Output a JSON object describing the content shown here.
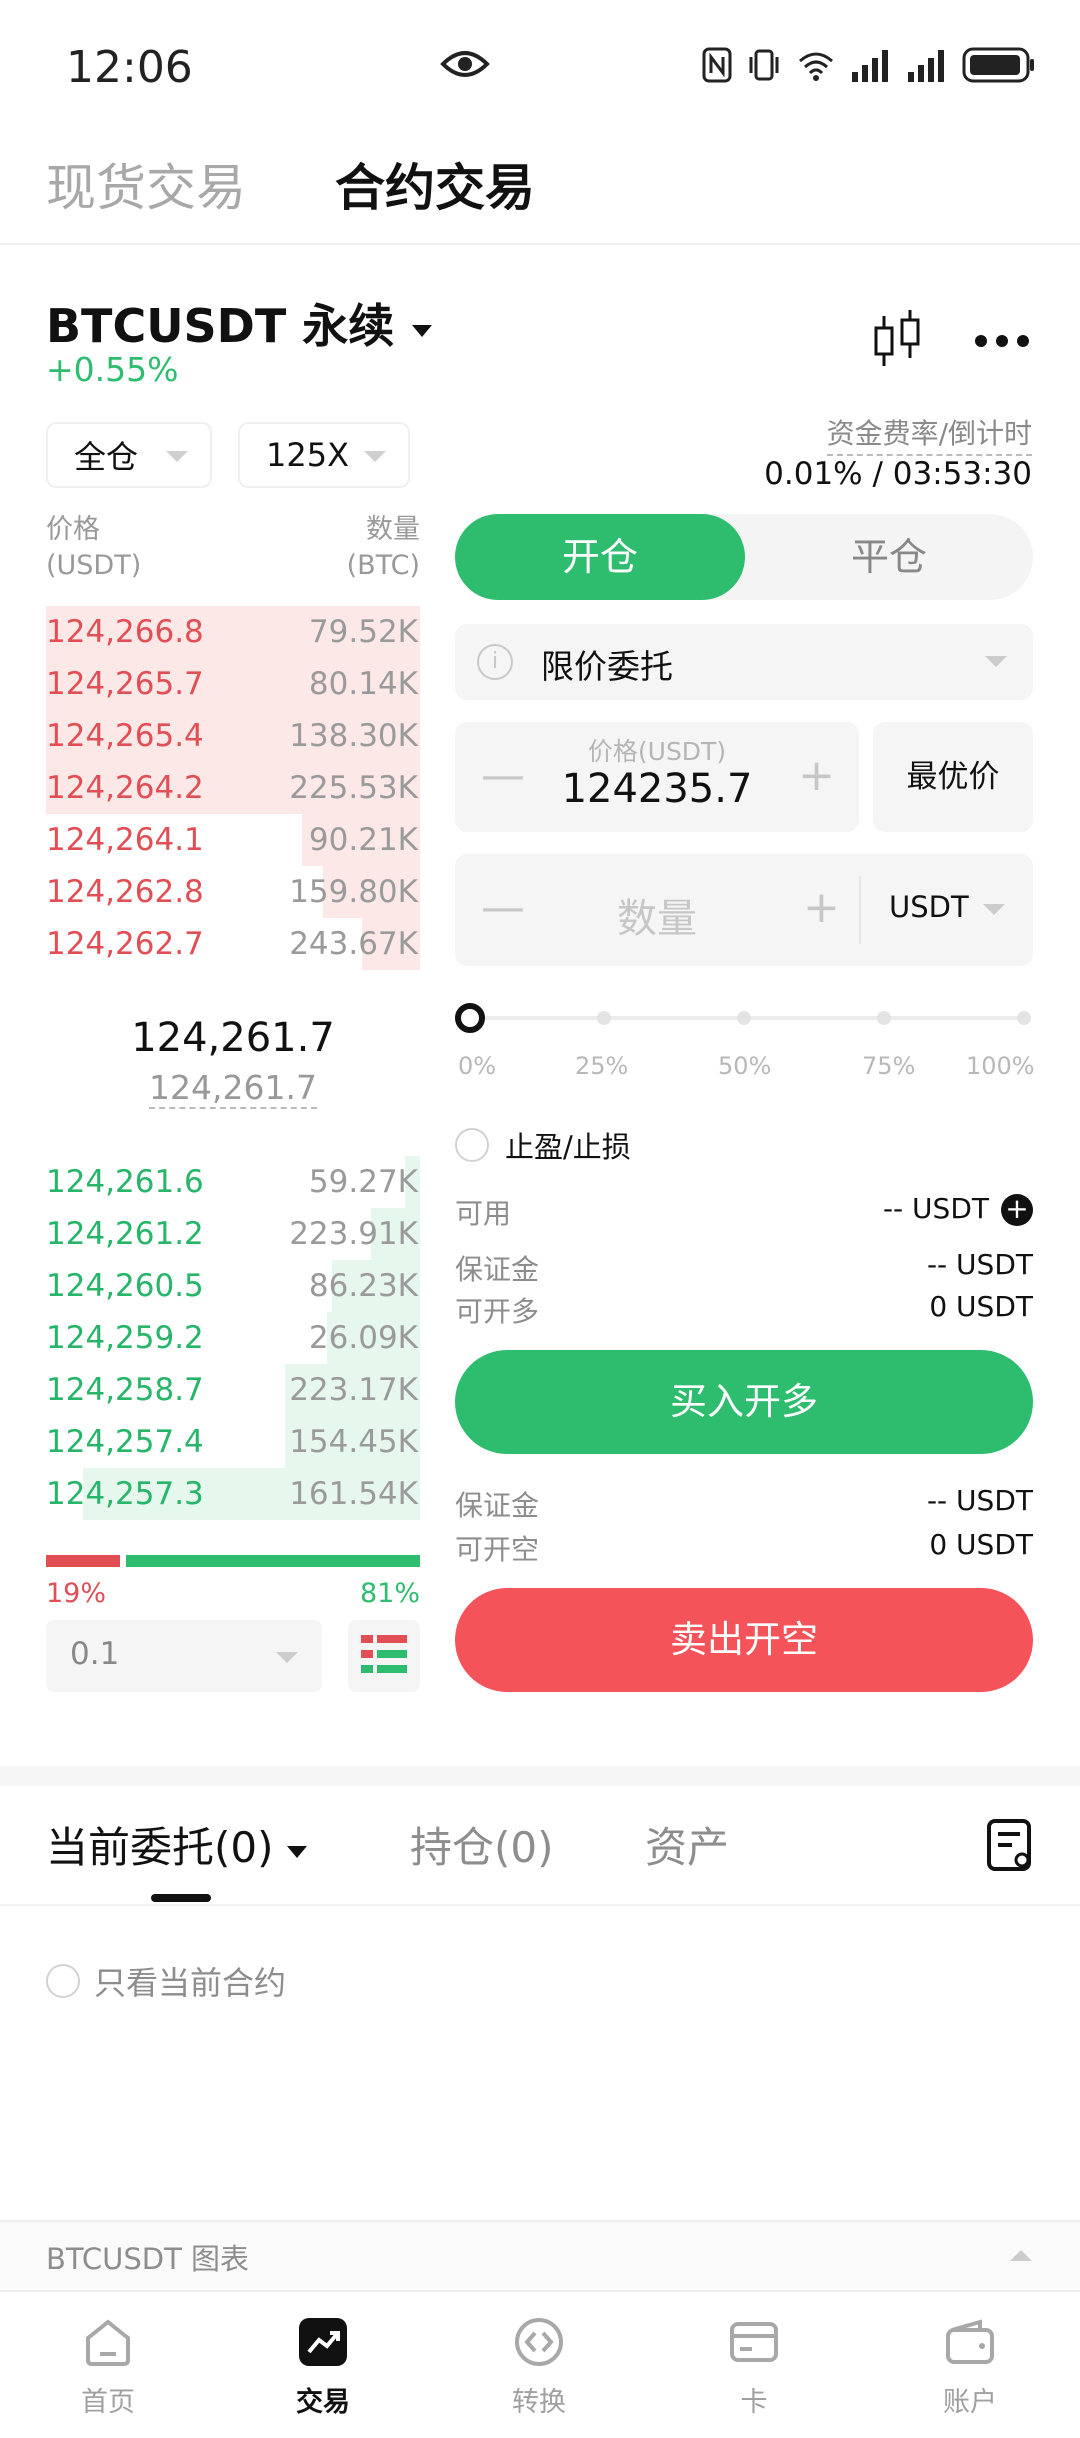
{
  "status_bar": {
    "time": "12:06"
  },
  "top_tabs": {
    "spot": "现货交易",
    "futures": "合约交易"
  },
  "header": {
    "symbol": "BTCUSDT 永续",
    "change": "+0.55%"
  },
  "controls": {
    "margin_mode": "全仓",
    "leverage": "125X"
  },
  "funding": {
    "label": "资金费率/倒计时",
    "value": "0.01% / 03:53:30"
  },
  "orderbook": {
    "price_label": "价格",
    "price_unit": "(USDT)",
    "qty_label": "数量",
    "qty_unit": "(BTC)",
    "asks": [
      {
        "price": "124,266.8",
        "qty": "79.52K",
        "depth": 1.0
      },
      {
        "price": "124,265.7",
        "qty": "80.14K",
        "depth": 1.0
      },
      {
        "price": "124,265.4",
        "qty": "138.30K",
        "depth": 1.0
      },
      {
        "price": "124,264.2",
        "qty": "225.53K",
        "depth": 1.0
      },
      {
        "price": "124,264.1",
        "qty": "90.21K",
        "depth": 0.315
      },
      {
        "price": "124,262.8",
        "qty": "159.80K",
        "depth": 0.26
      },
      {
        "price": "124,262.7",
        "qty": "243.67K",
        "depth": 0.155
      }
    ],
    "last_price": "124,261.7",
    "mark_price": "124,261.7",
    "bids": [
      {
        "price": "124,261.6",
        "qty": "59.27K",
        "depth": 0.04
      },
      {
        "price": "124,261.2",
        "qty": "223.91K",
        "depth": 0.13
      },
      {
        "price": "124,260.5",
        "qty": "86.23K",
        "depth": 0.235
      },
      {
        "price": "124,259.2",
        "qty": "26.09K",
        "depth": 0.25
      },
      {
        "price": "124,258.7",
        "qty": "223.17K",
        "depth": 0.36
      },
      {
        "price": "124,257.4",
        "qty": "154.45K",
        "depth": 0.36
      },
      {
        "price": "124,257.3",
        "qty": "161.54K",
        "depth": 0.9
      }
    ],
    "sell_ratio": "19%",
    "buy_ratio": "81%",
    "depth_step": "0.1"
  },
  "trade_panel": {
    "open_tab": "开仓",
    "close_tab": "平仓",
    "order_type": "限价委托",
    "price_caption": "价格(USDT)",
    "price_value": "124235.7",
    "best_price": "最优价",
    "qty_placeholder": "数量",
    "qty_unit": "USDT",
    "slider_value": 0,
    "slider_marks": [
      "0%",
      "25%",
      "50%",
      "75%",
      "100%"
    ],
    "tp_sl": "止盈/止损",
    "available_label": "可用",
    "available_value": "-- USDT",
    "long_margin_label": "保证金",
    "long_margin_value": "-- USDT",
    "long_max_label": "可开多",
    "long_max_value": "0 USDT",
    "buy_button": "买入开多",
    "short_margin_label": "保证金",
    "short_margin_value": "-- USDT",
    "short_max_label": "可开空",
    "short_max_value": "0 USDT",
    "sell_button": "卖出开空"
  },
  "bottom_tabs": {
    "current_orders": "当前委托(0)",
    "positions": "持仓(0)",
    "assets": "资产"
  },
  "filter": {
    "only_current": "只看当前合约"
  },
  "chart_bar": {
    "label": "BTCUSDT 图表"
  },
  "nav": {
    "home": "首页",
    "trade": "交易",
    "convert": "转换",
    "card": "卡",
    "account": "账户"
  },
  "colors": {
    "green": "#2ebd6e",
    "red": "#f4535a",
    "ask_bg": "#fde8e8",
    "bid_bg": "#e6f7ee"
  }
}
